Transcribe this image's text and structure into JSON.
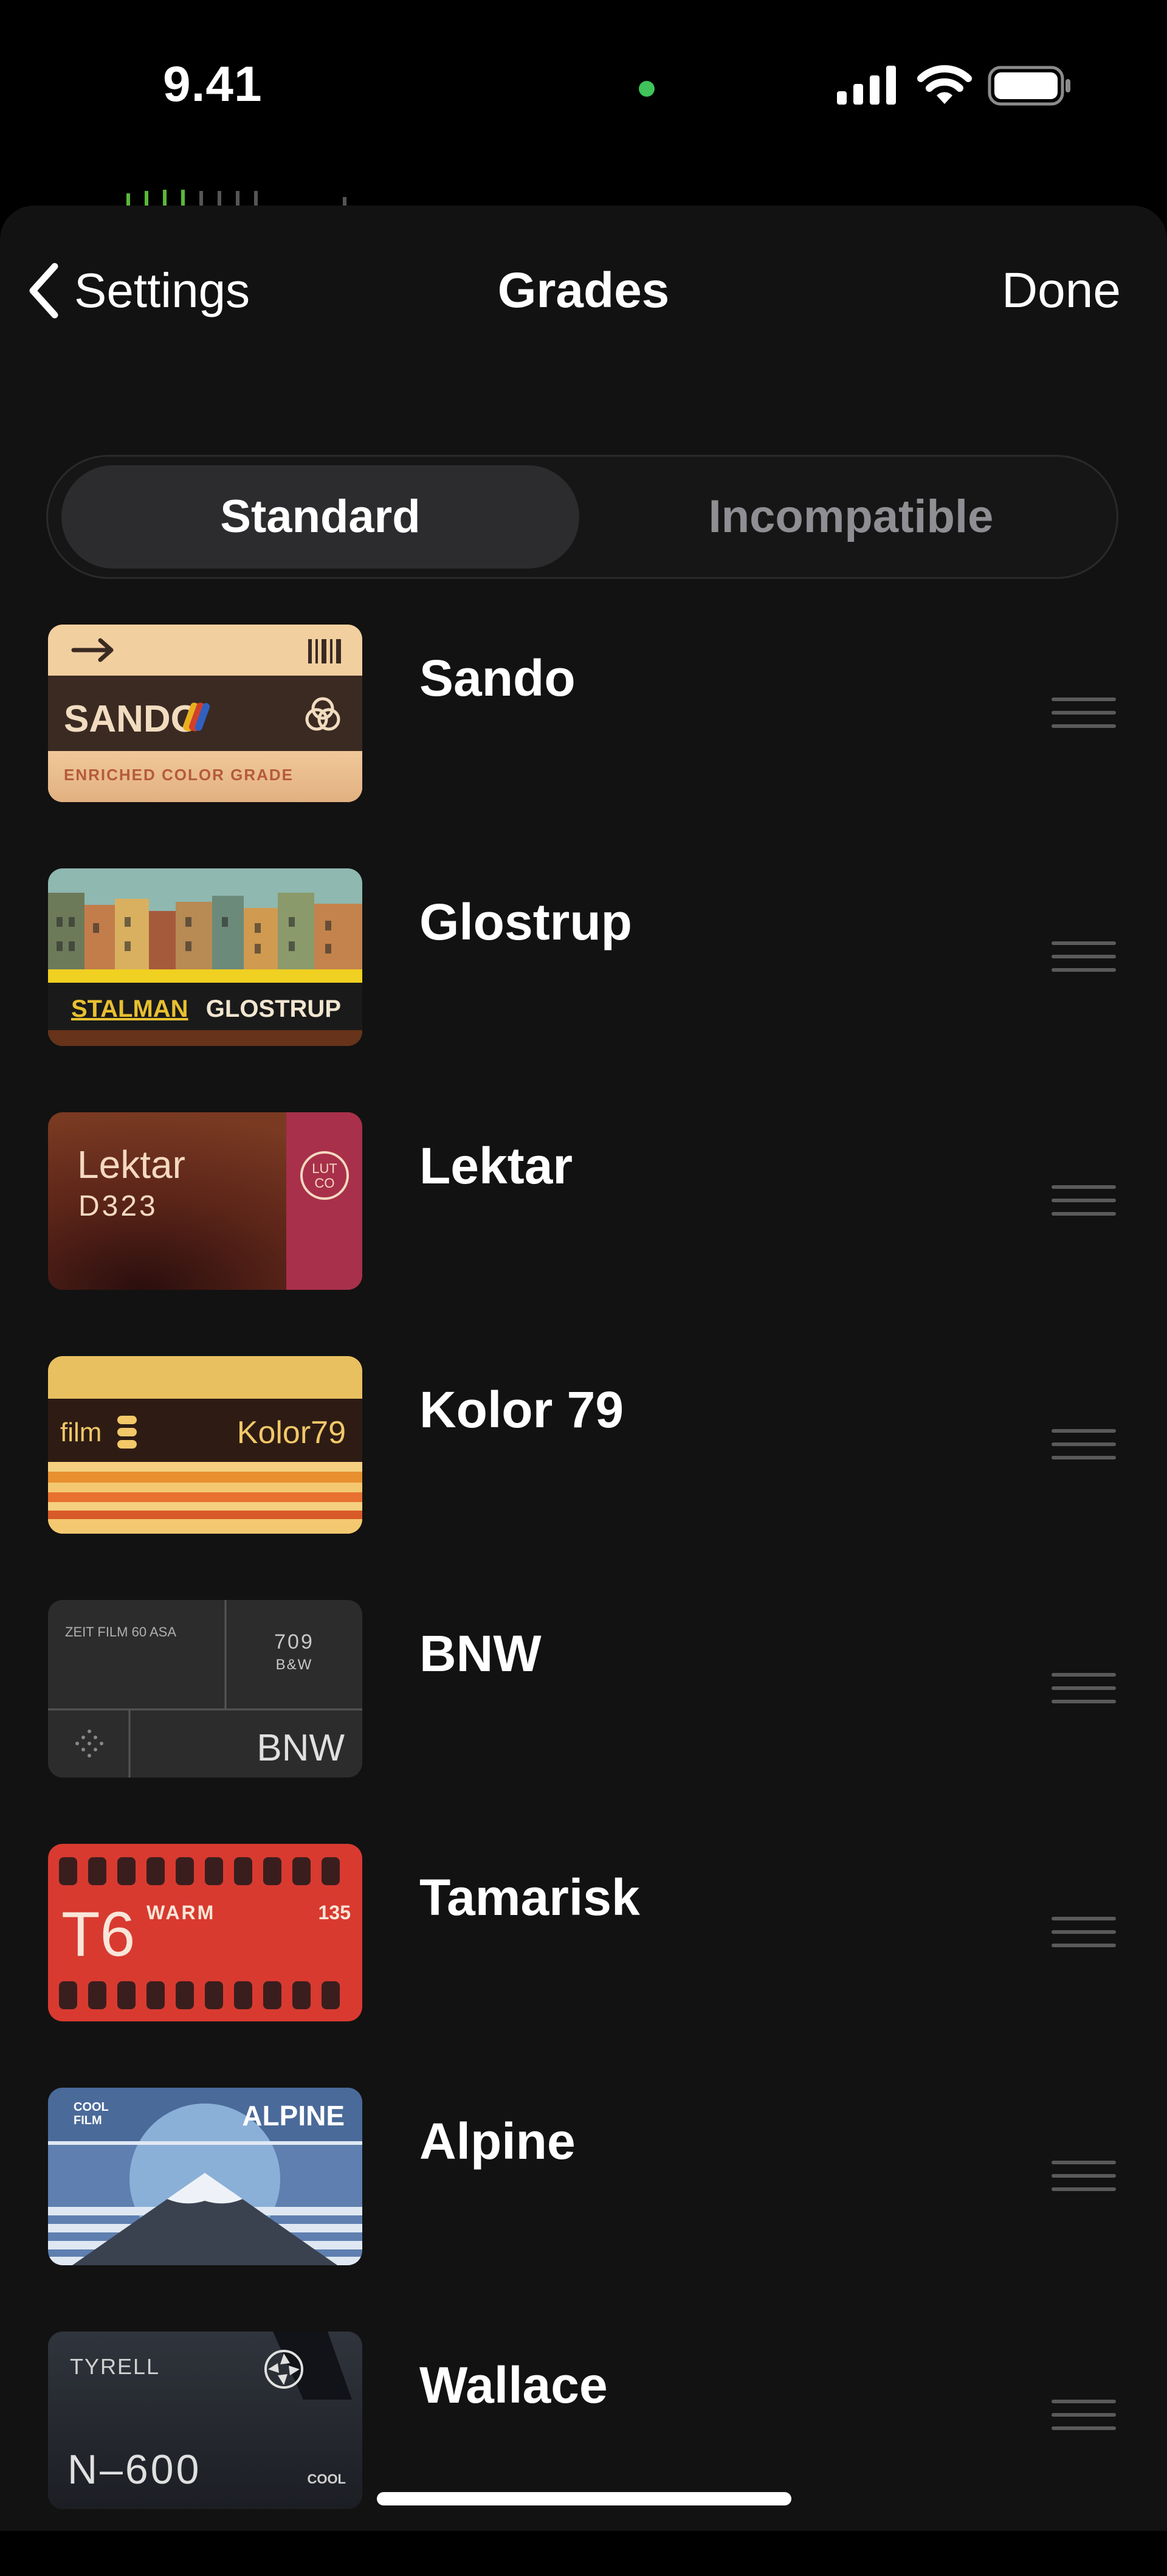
{
  "status_bar": {
    "time": "9.41",
    "recording_dot_color": "#3fc35a"
  },
  "nav": {
    "back_label": "Settings",
    "title": "Grades",
    "done_label": "Done"
  },
  "segmented": {
    "standard_label": "Standard",
    "incompatible_label": "Incompatible",
    "selected": "Standard"
  },
  "grades": [
    {
      "name": "Sando",
      "thumb": {
        "title": "SANDO",
        "subtitle": "ENRICHED COLOR GRADE"
      }
    },
    {
      "name": "Glostrup",
      "thumb": {
        "left": "STALMAN",
        "right": "GLOSTRUP"
      }
    },
    {
      "name": "Lektar",
      "thumb": {
        "title": "Lektar",
        "code": "D323",
        "badge_top": "LUT",
        "badge_bottom": "CO"
      }
    },
    {
      "name": "Kolor 79",
      "thumb": {
        "left": "film",
        "right": "Kolor79"
      }
    },
    {
      "name": "BNW",
      "thumb": {
        "top_left": "ZEIT FILM 60 ASA",
        "top_right_num": "709",
        "top_right_text": "B&W",
        "title": "BNW"
      }
    },
    {
      "name": "Tamarisk",
      "thumb": {
        "code": "T6",
        "tag": "WARM",
        "num": "135"
      }
    },
    {
      "name": "Alpine",
      "thumb": {
        "tag_top": "COOL",
        "tag_bottom": "FILM",
        "title": "ALPINE"
      }
    },
    {
      "name": "Wallace",
      "thumb": {
        "brand": "TYRELL",
        "code": "N–600",
        "tag": "COOL"
      }
    }
  ]
}
